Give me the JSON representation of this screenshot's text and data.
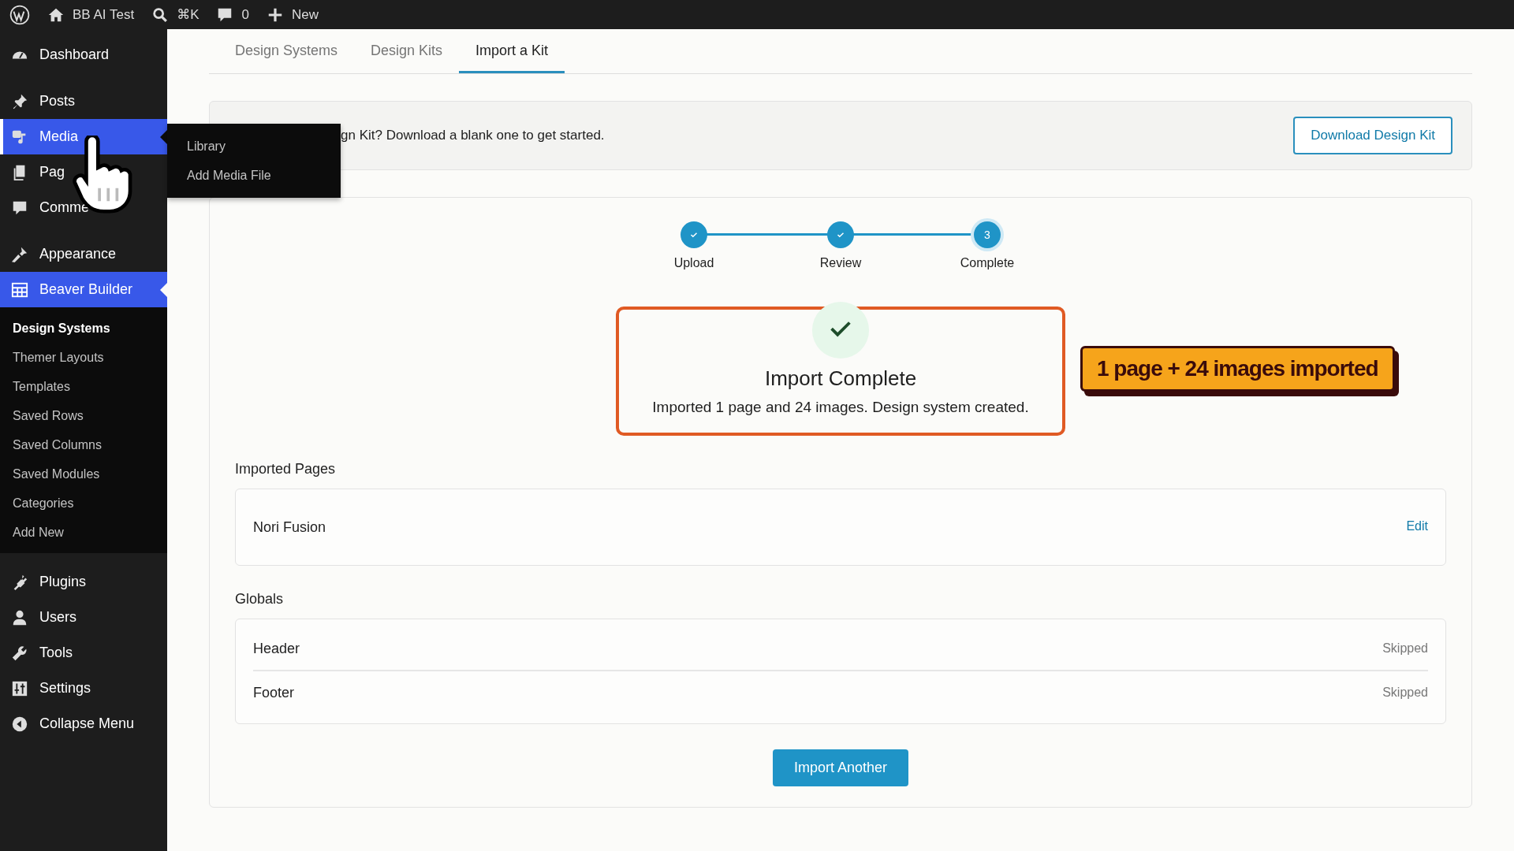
{
  "admin_bar": {
    "site_name": "BB AI Test",
    "shortcut": "⌘K",
    "comments_count": "0",
    "new_label": "New"
  },
  "sidebar": {
    "items": [
      {
        "label": "Dashboard",
        "selected": false,
        "hovered": false
      },
      {
        "label": "Posts",
        "selected": false,
        "hovered": false
      },
      {
        "label": "Media",
        "selected": false,
        "hovered": true
      },
      {
        "label": "Pag",
        "selected": false,
        "hovered": false
      },
      {
        "label": "Comme",
        "selected": false,
        "hovered": false
      },
      {
        "label": "Appearance",
        "selected": false,
        "hovered": false
      },
      {
        "label": "Beaver Builder",
        "selected": true,
        "hovered": false,
        "children": [
          {
            "label": "Design Systems",
            "selected": true
          },
          {
            "label": "Themer Layouts",
            "selected": false
          },
          {
            "label": "Templates",
            "selected": false
          },
          {
            "label": "Saved Rows",
            "selected": false
          },
          {
            "label": "Saved Columns",
            "selected": false
          },
          {
            "label": "Saved Modules",
            "selected": false
          },
          {
            "label": "Categories",
            "selected": false
          },
          {
            "label": "Add New",
            "selected": false
          }
        ]
      },
      {
        "label": "Plugins",
        "selected": false,
        "hovered": false
      },
      {
        "label": "Users",
        "selected": false,
        "hovered": false
      },
      {
        "label": "Tools",
        "selected": false,
        "hovered": false
      },
      {
        "label": "Settings",
        "selected": false,
        "hovered": false
      },
      {
        "label": "Collapse Menu",
        "selected": false,
        "hovered": false
      }
    ]
  },
  "flyout_menu": {
    "items": [
      "Library",
      "Add Media File"
    ]
  },
  "tabs": [
    {
      "label": "Design Systems",
      "selected": false
    },
    {
      "label": "Design Kits",
      "selected": false
    },
    {
      "label": "Import a Kit",
      "selected": true
    }
  ],
  "banner": {
    "text": "gn Kit? Download a blank one to get started.",
    "button": "Download Design Kit"
  },
  "steps": [
    {
      "label": "Upload",
      "completed": true
    },
    {
      "label": "Review",
      "completed": true
    },
    {
      "label": "Complete",
      "completed": false,
      "number": "3"
    }
  ],
  "result": {
    "title": "Import Complete",
    "message": "Imported 1 page and 24 images. Design system created."
  },
  "callout": "1 page + 24 images imported",
  "imported_pages": {
    "heading": "Imported Pages",
    "rows": [
      {
        "name": "Nori Fusion",
        "action": "Edit"
      }
    ]
  },
  "globals": {
    "heading": "Globals",
    "rows": [
      {
        "name": "Header",
        "status": "Skipped"
      },
      {
        "name": "Footer",
        "status": "Skipped"
      }
    ]
  },
  "primary_button": "Import Another"
}
